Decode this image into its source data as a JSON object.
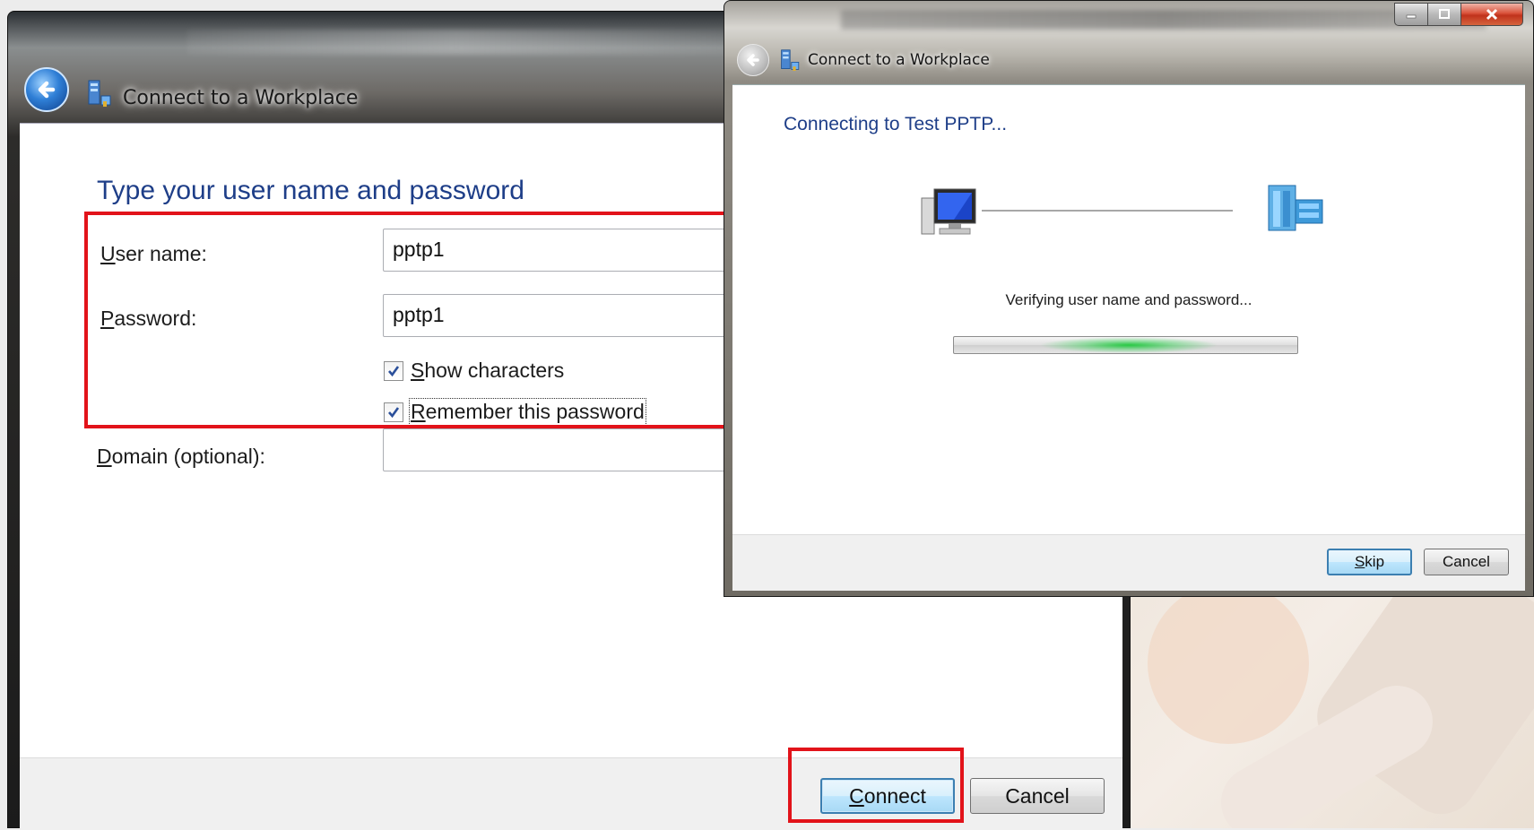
{
  "main_window": {
    "title": "Connect to a Workplace",
    "heading": "Type your user name and password",
    "username_label_ul": "U",
    "username_label_rest": "ser name:",
    "username_value": "pptp1",
    "password_label_ul": "P",
    "password_label_rest": "assword:",
    "password_value": "pptp1",
    "show_characters_ul": "S",
    "show_characters_rest": "how characters",
    "show_characters_checked": true,
    "remember_password_ul": "R",
    "remember_password_rest": "emember this password",
    "remember_password_checked": true,
    "domain_label_ul": "D",
    "domain_label_rest": "omain (optional):",
    "domain_value": "",
    "connect_ul": "C",
    "connect_rest": "onnect",
    "cancel_label": "Cancel"
  },
  "connecting_window": {
    "title": "Connect to a Workplace",
    "heading": "Connecting to Test PPTP...",
    "status": "Verifying user name and password...",
    "skip_ul": "S",
    "skip_rest": "kip",
    "cancel_label": "Cancel",
    "progress_state": "indeterminate"
  },
  "colors": {
    "heading_blue": "#1e3e88",
    "highlight_red": "#e2131a",
    "progress_green": "#1ec83c"
  }
}
